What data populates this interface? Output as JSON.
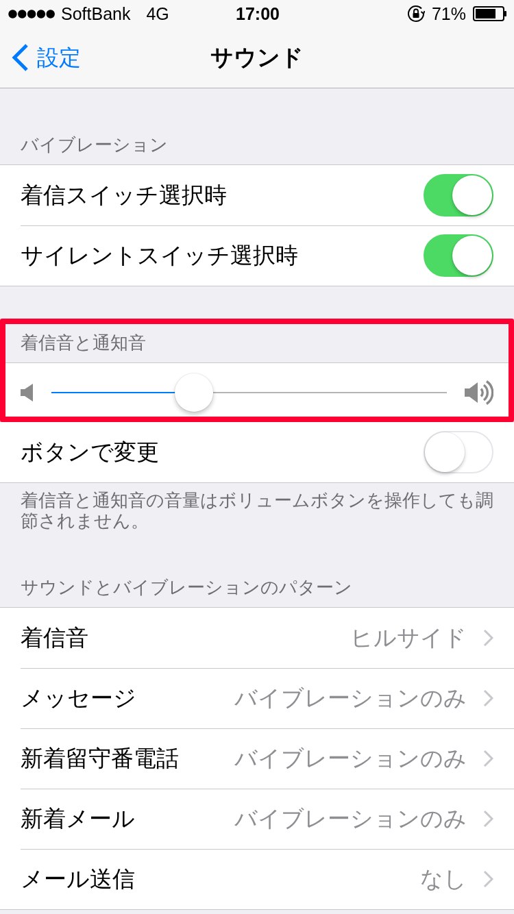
{
  "status_bar": {
    "carrier": "SoftBank",
    "network": "4G",
    "time": "17:00",
    "battery_percent": "71%"
  },
  "nav_bar": {
    "back_label": "設定",
    "title": "サウンド"
  },
  "sections": [
    {
      "header": "バイブレーション",
      "items": [
        {
          "kind": "toggle",
          "label": "着信スイッチ選択時",
          "on": true
        },
        {
          "kind": "toggle",
          "label": "サイレントスイッチ選択時",
          "on": true
        }
      ]
    },
    {
      "header": "着信音と通知音",
      "highlighted": true,
      "items": [
        {
          "kind": "slider",
          "level": 0.36
        }
      ]
    },
    {
      "items": [
        {
          "kind": "toggle",
          "label": "ボタンで変更",
          "on": false
        }
      ],
      "footer": "着信音と通知音の音量はボリュームボタンを操作しても調節されません。"
    },
    {
      "header": "サウンドとバイブレーションのパターン",
      "items": [
        {
          "kind": "link",
          "label": "着信音",
          "value": "ヒルサイド"
        },
        {
          "kind": "link",
          "label": "メッセージ",
          "value": "バイブレーションのみ"
        },
        {
          "kind": "link",
          "label": "新着留守番電話",
          "value": "バイブレーションのみ"
        },
        {
          "kind": "link",
          "label": "新着メール",
          "value": "バイブレーションのみ"
        },
        {
          "kind": "link",
          "label": "メール送信",
          "value": "なし"
        }
      ]
    }
  ]
}
